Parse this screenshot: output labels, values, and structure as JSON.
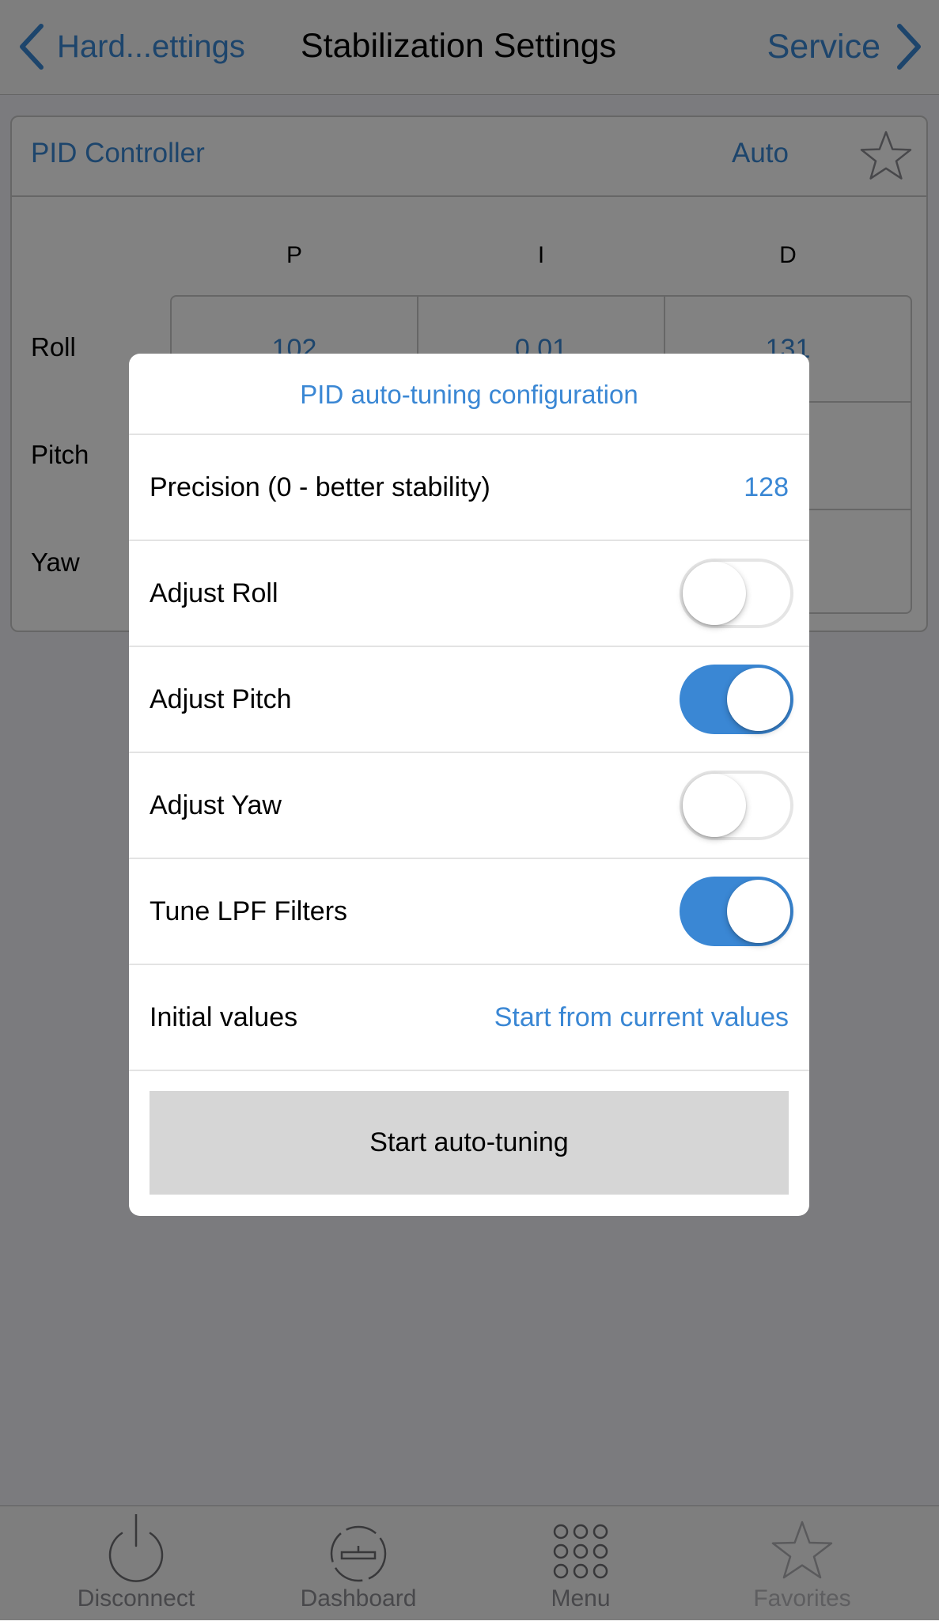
{
  "navbar": {
    "back_label": "Hard...ettings",
    "title": "Stabilization Settings",
    "forward_label": "Service"
  },
  "pid_panel": {
    "title": "PID Controller",
    "mode": "Auto",
    "columns": [
      "P",
      "I",
      "D"
    ],
    "rows": [
      {
        "label": "Roll",
        "values": [
          "102",
          "0.01",
          "131"
        ]
      },
      {
        "label": "Pitch",
        "values": [
          "",
          "",
          ""
        ]
      },
      {
        "label": "Yaw",
        "values": [
          "",
          "",
          ""
        ]
      }
    ]
  },
  "dialog": {
    "title": "PID auto-tuning configuration",
    "precision_label": "Precision (0 - better stability)",
    "precision_value": "128",
    "toggles": [
      {
        "label": "Adjust Roll",
        "on": false
      },
      {
        "label": "Adjust Pitch",
        "on": true
      },
      {
        "label": "Adjust Yaw",
        "on": false
      },
      {
        "label": "Tune LPF Filters",
        "on": true
      }
    ],
    "initial_label": "Initial values",
    "initial_value": "Start from current values",
    "start_button": "Start auto-tuning"
  },
  "tabbar": {
    "items": [
      {
        "label": "Disconnect",
        "icon": "power-icon"
      },
      {
        "label": "Dashboard",
        "icon": "gauge-icon"
      },
      {
        "label": "Menu",
        "icon": "grid-dots-icon"
      },
      {
        "label": "Favorites",
        "icon": "star-icon"
      }
    ]
  },
  "colors": {
    "accent": "#3a87d4",
    "overlay": "rgba(0,0,0,0.49)",
    "toggle_off_border": "#e5e5e5",
    "button_bg": "#d6d6d6"
  }
}
